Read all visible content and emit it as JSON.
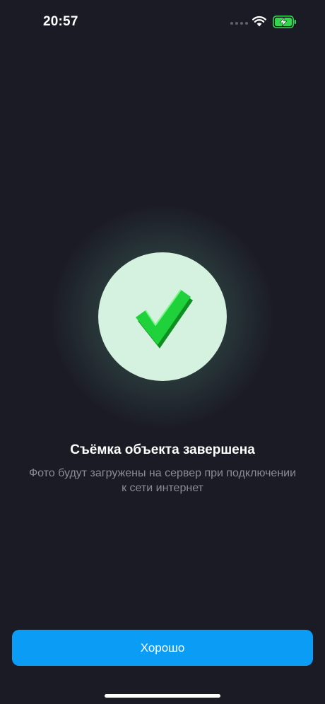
{
  "status_bar": {
    "time": "20:57",
    "icons": [
      "cellular-dots-icon",
      "wifi-icon",
      "battery-charging-icon"
    ],
    "battery_color": "#32d74b"
  },
  "success": {
    "icon": "check-icon",
    "circle_color": "#d5f1df",
    "check_color": "#1fd13a"
  },
  "message": {
    "title": "Съёмка объекта завершена",
    "subtitle_line1": "Фото будут загружены на сервер при подключении",
    "subtitle_line2": "к сети интернет"
  },
  "actions": {
    "ok_label": "Хорошо",
    "ok_color": "#0b9cf5"
  }
}
